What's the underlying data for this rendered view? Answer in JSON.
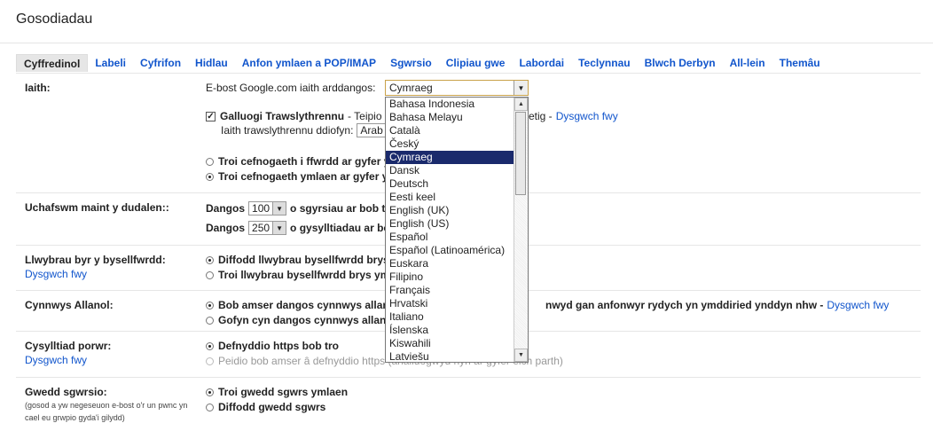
{
  "page_title": "Gosodiadau",
  "tabs": [
    "Cyffredinol",
    "Labeli",
    "Cyfrifon",
    "Hidlau",
    "Anfon ymlaen a POP/IMAP",
    "Sgwrsio",
    "Clipiau gwe",
    "Labordai",
    "Teclynnau",
    "Blwch Derbyn",
    "All-lein",
    "Themâu"
  ],
  "language": {
    "label": "Iaith:",
    "display_label": "E-bost Google.com iaith arddangos:",
    "selected": "Cymraeg",
    "options": [
      "Bahasa Indonesia",
      "Bahasa Melayu",
      "Català",
      "Český",
      "Cymraeg",
      "Dansk",
      "Deutsch",
      "Eesti keel",
      "English (UK)",
      "English (US)",
      "Español",
      "Español (Latinoamérica)",
      "Euskara",
      "Filipino",
      "Français",
      "Hrvatski",
      "Italiano",
      "Íslenska",
      "Kiswahili",
      "Latviešu"
    ],
    "translit_label": "Galluogi Trawslythrennu",
    "translit_tail_1": "- Teipio",
    "translit_tail_2": "etig -",
    "learn_more": "Dysgwch fwy",
    "translit_default_label": "Iaith trawslythrennu ddiofyn:",
    "translit_default_value": "Arab",
    "rtl_off": "Troi cefnogaeth i ffwrdd ar gyfer y",
    "rtl_on": "Troi cefnogaeth ymlaen ar gyfer y"
  },
  "page_size": {
    "label": "Uchafswm maint y dudalen::",
    "show": "Dangos",
    "conv_value": "100",
    "conv_text": "o sgyrsiau ar bob t",
    "contacts_value": "250",
    "contacts_text": "o gysylltiadau ar bo"
  },
  "shortcuts": {
    "label": "Llwybrau byr y bysellfwrdd:",
    "learn_more": "Dysgwch fwy",
    "off": "Diffodd llwybrau bysellfwrdd brys",
    "on": "Troi llwybrau bysellfwrdd brys ym"
  },
  "external": {
    "label": "Cynnwys Allanol:",
    "always": "Bob amser dangos cynnwys allan",
    "always_tail": "nwyd gan anfonwyr rydych yn ymddiried ynddyn nhw -",
    "learn_more": "Dysgwch fwy",
    "ask": "Gofyn cyn dangos cynnwys allan"
  },
  "browser": {
    "label": "Cysylltiad porwr:",
    "learn_more": "Dysgwch fwy",
    "https": "Defnyddio https bob tro",
    "no_https": "Peidio bob amser â defnyddio https (anaildogwyd hyn ar gyfer eich parth)"
  },
  "chat_view": {
    "label": "Gwedd sgwrsio:",
    "note": "(gosod a yw negeseuon e-bost o'r un pwnc yn cael eu grwpio gyda'i gilydd)",
    "on": "Troi gwedd sgwrs ymlaen",
    "off": "Diffodd gwedd sgwrs"
  }
}
